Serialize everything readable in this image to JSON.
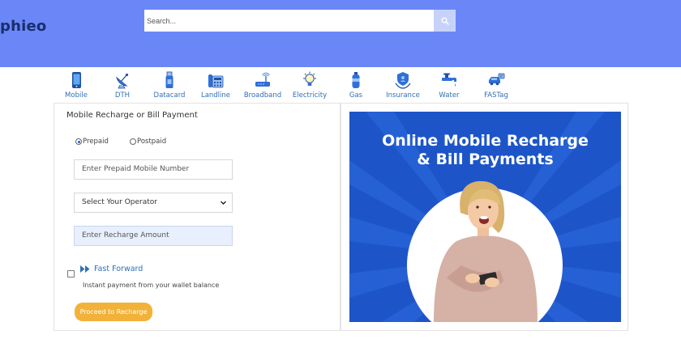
{
  "header": {
    "logo_text": "phieo",
    "search": {
      "placeholder": "Search...",
      "button_icon": "search-icon"
    },
    "bg_color": "#6b87f7"
  },
  "nav": {
    "items": [
      {
        "label": "Mobile",
        "icon": "mobile-icon"
      },
      {
        "label": "DTH",
        "icon": "satellite-dish-icon"
      },
      {
        "label": "Datacard",
        "icon": "usb-datacard-icon"
      },
      {
        "label": "Landline",
        "icon": "landline-phone-icon"
      },
      {
        "label": "Broadband",
        "icon": "router-icon"
      },
      {
        "label": "Electricity",
        "icon": "light-bulb-icon"
      },
      {
        "label": "Gas",
        "icon": "gas-cylinder-icon"
      },
      {
        "label": "Insurance",
        "icon": "insurance-icon"
      },
      {
        "label": "Water",
        "icon": "water-tap-icon"
      },
      {
        "label": "FASTag",
        "icon": "fastag-car-icon"
      }
    ]
  },
  "form": {
    "title": "Mobile Recharge or Bill Payment",
    "radios": [
      {
        "label": "Prepaid",
        "selected": true
      },
      {
        "label": "Postpaid",
        "selected": false
      }
    ],
    "mobile_placeholder": "Enter Prepaid Mobile Number",
    "operator_value": "Select Your Operator",
    "amount_placeholder": "Enter Recharge Amount",
    "fast_forward": {
      "title": "Fast Forward",
      "subtitle": "Instant payment from your wallet balance",
      "checked": false
    },
    "proceed_label": "Proceed to Recharge",
    "accent_color": "#f2b23a",
    "link_color": "#2f6fb7"
  },
  "banner": {
    "line1": "Online Mobile Recharge",
    "line2": "& Bill Payments",
    "bg_color": "#1d55c9"
  }
}
